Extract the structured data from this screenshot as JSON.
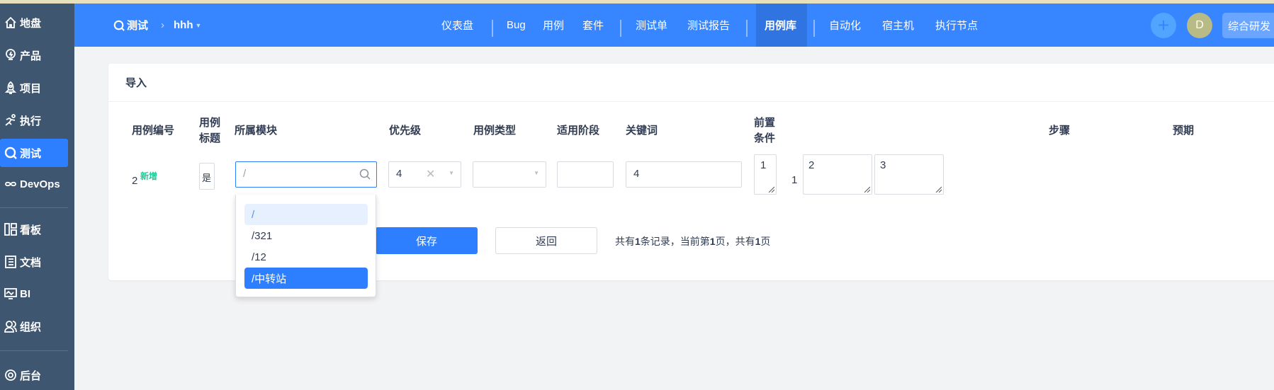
{
  "sidebar": {
    "items": [
      {
        "label": "地盘",
        "icon": "home-icon"
      },
      {
        "label": "产品",
        "icon": "bulb-icon"
      },
      {
        "label": "项目",
        "icon": "rocket-icon"
      },
      {
        "label": "执行",
        "icon": "run-icon"
      },
      {
        "label": "测试",
        "icon": "test-search-icon",
        "active": true
      },
      {
        "label": "DevOps",
        "icon": "infinity-icon"
      },
      {
        "label": "看板",
        "icon": "kanban-icon"
      },
      {
        "label": "文档",
        "icon": "doc-icon"
      },
      {
        "label": "BI",
        "icon": "monitor-icon"
      },
      {
        "label": "组织",
        "icon": "people-icon"
      },
      {
        "label": "后台",
        "icon": "gear-icon"
      }
    ]
  },
  "topbar": {
    "module": "测试",
    "product": "hhh",
    "nav": [
      "仪表盘",
      "Bug",
      "用例",
      "套件",
      "测试单",
      "测试报告",
      "用例库",
      "自动化",
      "宿主机",
      "执行节点"
    ],
    "active": "用例库",
    "avatar": "D",
    "workspace": "综合研发"
  },
  "card": {
    "title": "导入",
    "headers": {
      "id": "用例编号",
      "title_l1": "用例",
      "title_l2": "标题",
      "module": "所属模块",
      "priority": "优先级",
      "type": "用例类型",
      "stage": "适用阶段",
      "keywords": "关键词",
      "precond_l1": "前置",
      "precond_l2": "条件",
      "steps": "步骤",
      "expect": "预期"
    },
    "row": {
      "id": "2",
      "badge": "新增",
      "title": "是",
      "module_search": "/",
      "priority": "4",
      "type": "",
      "stage": "",
      "keywords": "4",
      "precondition": "1",
      "step_no": "1",
      "step": "2",
      "expect": "3"
    },
    "dropdown": [
      "/",
      "/321",
      "/12",
      "/中转站"
    ],
    "save": "保存",
    "back": "返回",
    "pager": {
      "p1": "共有",
      "total": "1",
      "p2": "条记录，当前第",
      "page": "1",
      "p3": "页，共有",
      "pages": "1",
      "p4": "页"
    }
  },
  "colors": {
    "primary": "#2e7fff",
    "topbar": "#3785ff",
    "sidebar": "#3f5670",
    "badge": "#17ce97"
  }
}
